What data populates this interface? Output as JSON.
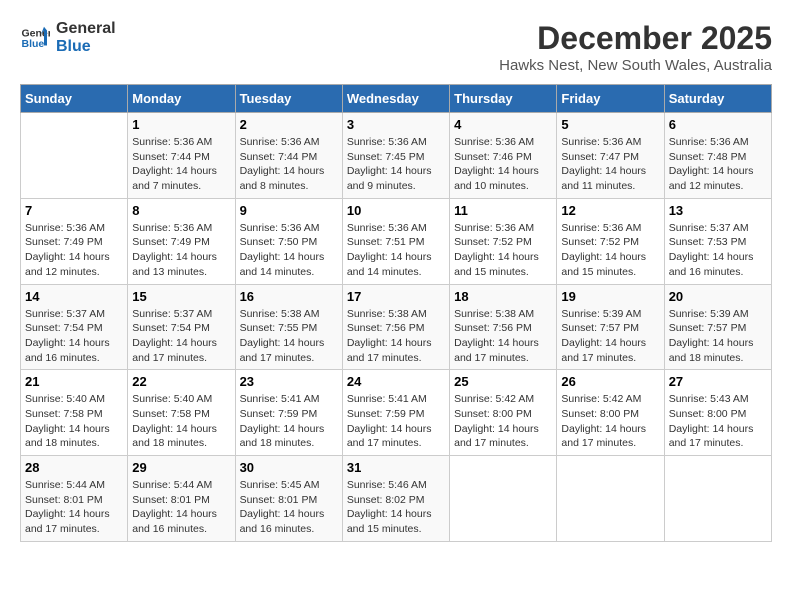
{
  "header": {
    "logo": {
      "line1": "General",
      "line2": "Blue"
    },
    "title": "December 2025",
    "subtitle": "Hawks Nest, New South Wales, Australia"
  },
  "weekdays": [
    "Sunday",
    "Monday",
    "Tuesday",
    "Wednesday",
    "Thursday",
    "Friday",
    "Saturday"
  ],
  "weeks": [
    [
      {
        "day": "",
        "sunrise": "",
        "sunset": "",
        "daylight": ""
      },
      {
        "day": "1",
        "sunrise": "Sunrise: 5:36 AM",
        "sunset": "Sunset: 7:44 PM",
        "daylight": "Daylight: 14 hours and 7 minutes."
      },
      {
        "day": "2",
        "sunrise": "Sunrise: 5:36 AM",
        "sunset": "Sunset: 7:44 PM",
        "daylight": "Daylight: 14 hours and 8 minutes."
      },
      {
        "day": "3",
        "sunrise": "Sunrise: 5:36 AM",
        "sunset": "Sunset: 7:45 PM",
        "daylight": "Daylight: 14 hours and 9 minutes."
      },
      {
        "day": "4",
        "sunrise": "Sunrise: 5:36 AM",
        "sunset": "Sunset: 7:46 PM",
        "daylight": "Daylight: 14 hours and 10 minutes."
      },
      {
        "day": "5",
        "sunrise": "Sunrise: 5:36 AM",
        "sunset": "Sunset: 7:47 PM",
        "daylight": "Daylight: 14 hours and 11 minutes."
      },
      {
        "day": "6",
        "sunrise": "Sunrise: 5:36 AM",
        "sunset": "Sunset: 7:48 PM",
        "daylight": "Daylight: 14 hours and 12 minutes."
      }
    ],
    [
      {
        "day": "7",
        "sunrise": "Sunrise: 5:36 AM",
        "sunset": "Sunset: 7:49 PM",
        "daylight": "Daylight: 14 hours and 12 minutes."
      },
      {
        "day": "8",
        "sunrise": "Sunrise: 5:36 AM",
        "sunset": "Sunset: 7:49 PM",
        "daylight": "Daylight: 14 hours and 13 minutes."
      },
      {
        "day": "9",
        "sunrise": "Sunrise: 5:36 AM",
        "sunset": "Sunset: 7:50 PM",
        "daylight": "Daylight: 14 hours and 14 minutes."
      },
      {
        "day": "10",
        "sunrise": "Sunrise: 5:36 AM",
        "sunset": "Sunset: 7:51 PM",
        "daylight": "Daylight: 14 hours and 14 minutes."
      },
      {
        "day": "11",
        "sunrise": "Sunrise: 5:36 AM",
        "sunset": "Sunset: 7:52 PM",
        "daylight": "Daylight: 14 hours and 15 minutes."
      },
      {
        "day": "12",
        "sunrise": "Sunrise: 5:36 AM",
        "sunset": "Sunset: 7:52 PM",
        "daylight": "Daylight: 14 hours and 15 minutes."
      },
      {
        "day": "13",
        "sunrise": "Sunrise: 5:37 AM",
        "sunset": "Sunset: 7:53 PM",
        "daylight": "Daylight: 14 hours and 16 minutes."
      }
    ],
    [
      {
        "day": "14",
        "sunrise": "Sunrise: 5:37 AM",
        "sunset": "Sunset: 7:54 PM",
        "daylight": "Daylight: 14 hours and 16 minutes."
      },
      {
        "day": "15",
        "sunrise": "Sunrise: 5:37 AM",
        "sunset": "Sunset: 7:54 PM",
        "daylight": "Daylight: 14 hours and 17 minutes."
      },
      {
        "day": "16",
        "sunrise": "Sunrise: 5:38 AM",
        "sunset": "Sunset: 7:55 PM",
        "daylight": "Daylight: 14 hours and 17 minutes."
      },
      {
        "day": "17",
        "sunrise": "Sunrise: 5:38 AM",
        "sunset": "Sunset: 7:56 PM",
        "daylight": "Daylight: 14 hours and 17 minutes."
      },
      {
        "day": "18",
        "sunrise": "Sunrise: 5:38 AM",
        "sunset": "Sunset: 7:56 PM",
        "daylight": "Daylight: 14 hours and 17 minutes."
      },
      {
        "day": "19",
        "sunrise": "Sunrise: 5:39 AM",
        "sunset": "Sunset: 7:57 PM",
        "daylight": "Daylight: 14 hours and 17 minutes."
      },
      {
        "day": "20",
        "sunrise": "Sunrise: 5:39 AM",
        "sunset": "Sunset: 7:57 PM",
        "daylight": "Daylight: 14 hours and 18 minutes."
      }
    ],
    [
      {
        "day": "21",
        "sunrise": "Sunrise: 5:40 AM",
        "sunset": "Sunset: 7:58 PM",
        "daylight": "Daylight: 14 hours and 18 minutes."
      },
      {
        "day": "22",
        "sunrise": "Sunrise: 5:40 AM",
        "sunset": "Sunset: 7:58 PM",
        "daylight": "Daylight: 14 hours and 18 minutes."
      },
      {
        "day": "23",
        "sunrise": "Sunrise: 5:41 AM",
        "sunset": "Sunset: 7:59 PM",
        "daylight": "Daylight: 14 hours and 18 minutes."
      },
      {
        "day": "24",
        "sunrise": "Sunrise: 5:41 AM",
        "sunset": "Sunset: 7:59 PM",
        "daylight": "Daylight: 14 hours and 17 minutes."
      },
      {
        "day": "25",
        "sunrise": "Sunrise: 5:42 AM",
        "sunset": "Sunset: 8:00 PM",
        "daylight": "Daylight: 14 hours and 17 minutes."
      },
      {
        "day": "26",
        "sunrise": "Sunrise: 5:42 AM",
        "sunset": "Sunset: 8:00 PM",
        "daylight": "Daylight: 14 hours and 17 minutes."
      },
      {
        "day": "27",
        "sunrise": "Sunrise: 5:43 AM",
        "sunset": "Sunset: 8:00 PM",
        "daylight": "Daylight: 14 hours and 17 minutes."
      }
    ],
    [
      {
        "day": "28",
        "sunrise": "Sunrise: 5:44 AM",
        "sunset": "Sunset: 8:01 PM",
        "daylight": "Daylight: 14 hours and 17 minutes."
      },
      {
        "day": "29",
        "sunrise": "Sunrise: 5:44 AM",
        "sunset": "Sunset: 8:01 PM",
        "daylight": "Daylight: 14 hours and 16 minutes."
      },
      {
        "day": "30",
        "sunrise": "Sunrise: 5:45 AM",
        "sunset": "Sunset: 8:01 PM",
        "daylight": "Daylight: 14 hours and 16 minutes."
      },
      {
        "day": "31",
        "sunrise": "Sunrise: 5:46 AM",
        "sunset": "Sunset: 8:02 PM",
        "daylight": "Daylight: 14 hours and 15 minutes."
      },
      {
        "day": "",
        "sunrise": "",
        "sunset": "",
        "daylight": ""
      },
      {
        "day": "",
        "sunrise": "",
        "sunset": "",
        "daylight": ""
      },
      {
        "day": "",
        "sunrise": "",
        "sunset": "",
        "daylight": ""
      }
    ]
  ]
}
